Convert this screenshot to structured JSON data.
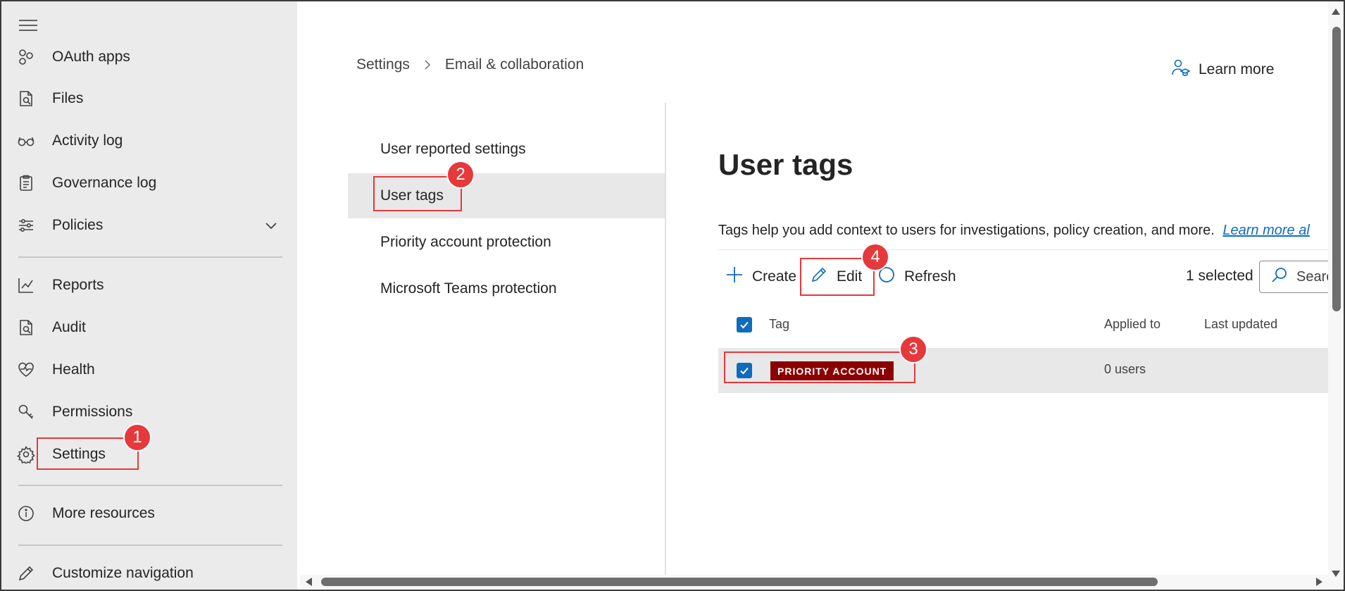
{
  "left_nav": {
    "items": [
      {
        "label": "OAuth apps",
        "icon": "oauth-apps-icon"
      },
      {
        "label": "Files",
        "icon": "files-icon"
      },
      {
        "label": "Activity log",
        "icon": "activity-log-icon"
      },
      {
        "label": "Governance log",
        "icon": "governance-log-icon"
      },
      {
        "label": "Policies",
        "icon": "policies-icon"
      },
      {
        "label": "Reports",
        "icon": "reports-icon"
      },
      {
        "label": "Audit",
        "icon": "audit-icon"
      },
      {
        "label": "Health",
        "icon": "health-icon"
      },
      {
        "label": "Permissions",
        "icon": "permissions-icon"
      },
      {
        "label": "Settings",
        "icon": "settings-icon"
      },
      {
        "label": "More resources",
        "icon": "info-icon"
      },
      {
        "label": "Customize navigation",
        "icon": "pencil-icon"
      }
    ]
  },
  "breadcrumb": {
    "root": "Settings",
    "current": "Email & collaboration"
  },
  "learn_more": "Learn more",
  "sub_nav": {
    "items": [
      {
        "label": "User reported settings"
      },
      {
        "label": "User tags",
        "active": true
      },
      {
        "label": "Priority account protection"
      },
      {
        "label": "Microsoft Teams protection"
      }
    ]
  },
  "page": {
    "title": "User tags",
    "description": "Tags help you add context to users for investigations, policy creation, and more.",
    "description_link": "Learn more al"
  },
  "toolbar": {
    "create": "Create",
    "edit": "Edit",
    "refresh": "Refresh",
    "selected_count": "1 selected",
    "search": "Search"
  },
  "table": {
    "columns": [
      "Tag",
      "Applied to",
      "Last updated"
    ],
    "rows": [
      {
        "tag": "PRIORITY ACCOUNT",
        "applied_to": "0 users",
        "last_updated": "",
        "selected": true
      }
    ]
  },
  "annotations": [
    "1",
    "2",
    "3",
    "4"
  ],
  "colors": {
    "accent": "#0f6cbd",
    "annotation": "#e5393b",
    "tag_background": "#8b0000",
    "nav_background": "#ebebeb"
  }
}
